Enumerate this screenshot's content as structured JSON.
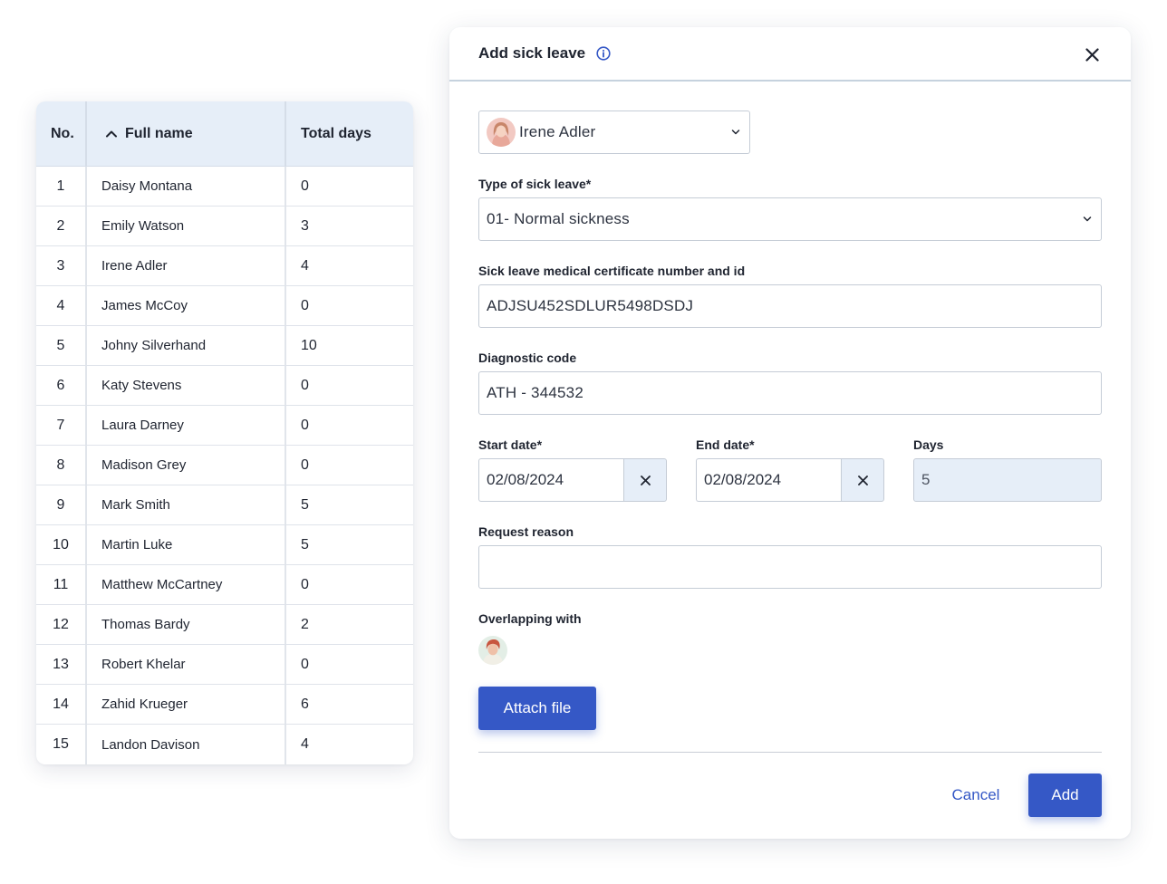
{
  "table": {
    "columns": {
      "no": "No.",
      "name": "Full name",
      "days": "Total days"
    },
    "rows": [
      {
        "no": "1",
        "name": "Daisy Montana",
        "days": "0"
      },
      {
        "no": "2",
        "name": "Emily Watson",
        "days": "3"
      },
      {
        "no": "3",
        "name": "Irene Adler",
        "days": "4"
      },
      {
        "no": "4",
        "name": "James McCoy",
        "days": "0"
      },
      {
        "no": "5",
        "name": "Johny Silverhand",
        "days": "10"
      },
      {
        "no": "6",
        "name": "Katy Stevens",
        "days": "0"
      },
      {
        "no": "7",
        "name": "Laura Darney",
        "days": "0"
      },
      {
        "no": "8",
        "name": "Madison Grey",
        "days": "0"
      },
      {
        "no": "9",
        "name": "Mark Smith",
        "days": "5"
      },
      {
        "no": "10",
        "name": "Martin Luke",
        "days": "5"
      },
      {
        "no": "11",
        "name": "Matthew McCartney",
        "days": "0"
      },
      {
        "no": "12",
        "name": "Thomas Bardy",
        "days": "2"
      },
      {
        "no": "13",
        "name": "Robert Khelar",
        "days": "0"
      },
      {
        "no": "14",
        "name": "Zahid Krueger",
        "days": "6"
      },
      {
        "no": "15",
        "name": "Landon Davison",
        "days": "4"
      }
    ]
  },
  "modal": {
    "title": "Add sick leave",
    "employee": {
      "name": "Irene Adler"
    },
    "type": {
      "label": "Type of sick leave*",
      "value": "01- Normal sickness"
    },
    "certificate": {
      "label": "Sick leave medical certificate number and id",
      "value": "ADJSU452SDLUR5498DSDJ"
    },
    "diagnostic": {
      "label": "Diagnostic code",
      "value": "ATH - 344532"
    },
    "start_date": {
      "label": "Start date*",
      "value": "02/08/2024"
    },
    "end_date": {
      "label": "End date*",
      "value": "02/08/2024"
    },
    "days": {
      "label": "Days",
      "value": "5"
    },
    "reason": {
      "label": "Request reason",
      "value": ""
    },
    "overlapping": {
      "label": "Overlapping with"
    },
    "attach_label": "Attach file",
    "cancel_label": "Cancel",
    "add_label": "Add"
  },
  "colors": {
    "accent": "#3558c6",
    "header_bg": "#e6eef8",
    "border": "#c5ccd6"
  },
  "icons": {
    "sort": "chevron-up-icon",
    "info": "info-circle-icon",
    "close": "close-icon",
    "dropdown": "chevron-down-icon",
    "clear": "clear-x-icon"
  }
}
